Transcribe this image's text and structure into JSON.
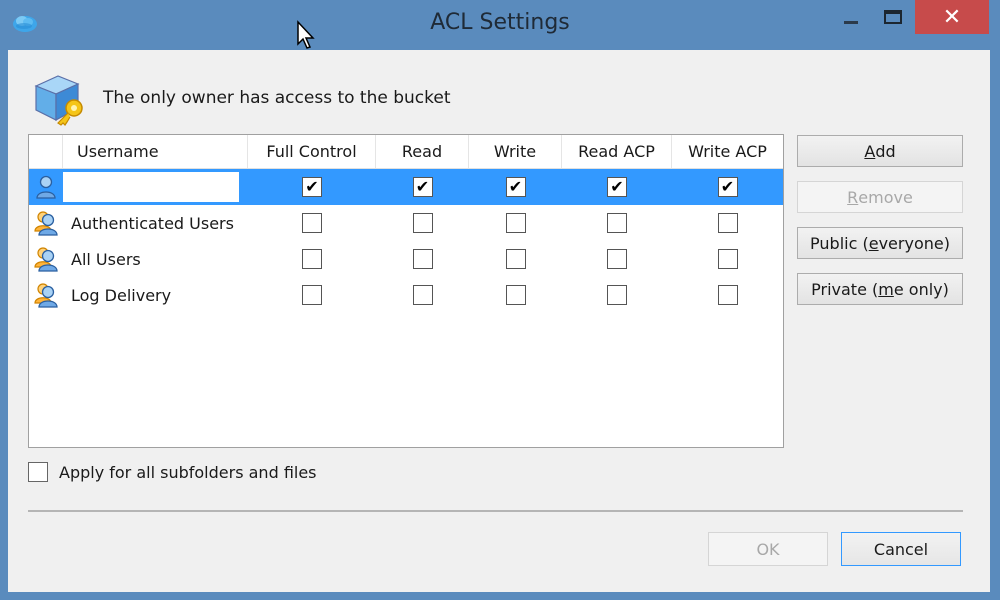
{
  "window": {
    "title": "ACL Settings",
    "close_glyph": "✕",
    "icons": {
      "app": "cloud-icon",
      "minimize": "minimize-icon",
      "maximize": "maximize-icon",
      "close": "close-icon"
    }
  },
  "header": {
    "message": "The only owner has access to the bucket",
    "icon": "bucket-key-icon"
  },
  "grid": {
    "columns": [
      "",
      "Username",
      "Full Control",
      "Read",
      "Write",
      "Read ACP",
      "Write ACP"
    ],
    "rows": [
      {
        "username": "",
        "icon": "user-icon",
        "selected": true,
        "editing": true,
        "permissions": [
          true,
          true,
          true,
          true,
          true
        ]
      },
      {
        "username": "Authenticated Users",
        "icon": "group-icon",
        "selected": false,
        "permissions": [
          false,
          false,
          false,
          false,
          false
        ]
      },
      {
        "username": "All Users",
        "icon": "group-icon",
        "selected": false,
        "permissions": [
          false,
          false,
          false,
          false,
          false
        ]
      },
      {
        "username": "Log Delivery",
        "icon": "group-icon",
        "selected": false,
        "permissions": [
          false,
          false,
          false,
          false,
          false
        ]
      }
    ],
    "check_glyph": "✔"
  },
  "side_buttons": {
    "add": {
      "pre": "",
      "accel": "A",
      "post": "dd",
      "enabled": true
    },
    "remove": {
      "pre": "",
      "accel": "R",
      "post": "emove",
      "enabled": false
    },
    "public": {
      "pre": "Public (",
      "accel": "e",
      "post": "veryone)",
      "enabled": true
    },
    "private": {
      "pre": "Private (",
      "accel": "m",
      "post": "e only)",
      "enabled": true
    }
  },
  "apply_all": {
    "label": "Apply for all subfolders and files",
    "checked": false
  },
  "footer": {
    "ok": {
      "label": "OK",
      "enabled": false
    },
    "cancel": {
      "label": "Cancel",
      "enabled": true
    }
  },
  "colors": {
    "titlebar": "#5a8bbd",
    "close_button": "#c74b4b",
    "selection": "#3399ff",
    "dialog_bg": "#f0f0f0"
  }
}
